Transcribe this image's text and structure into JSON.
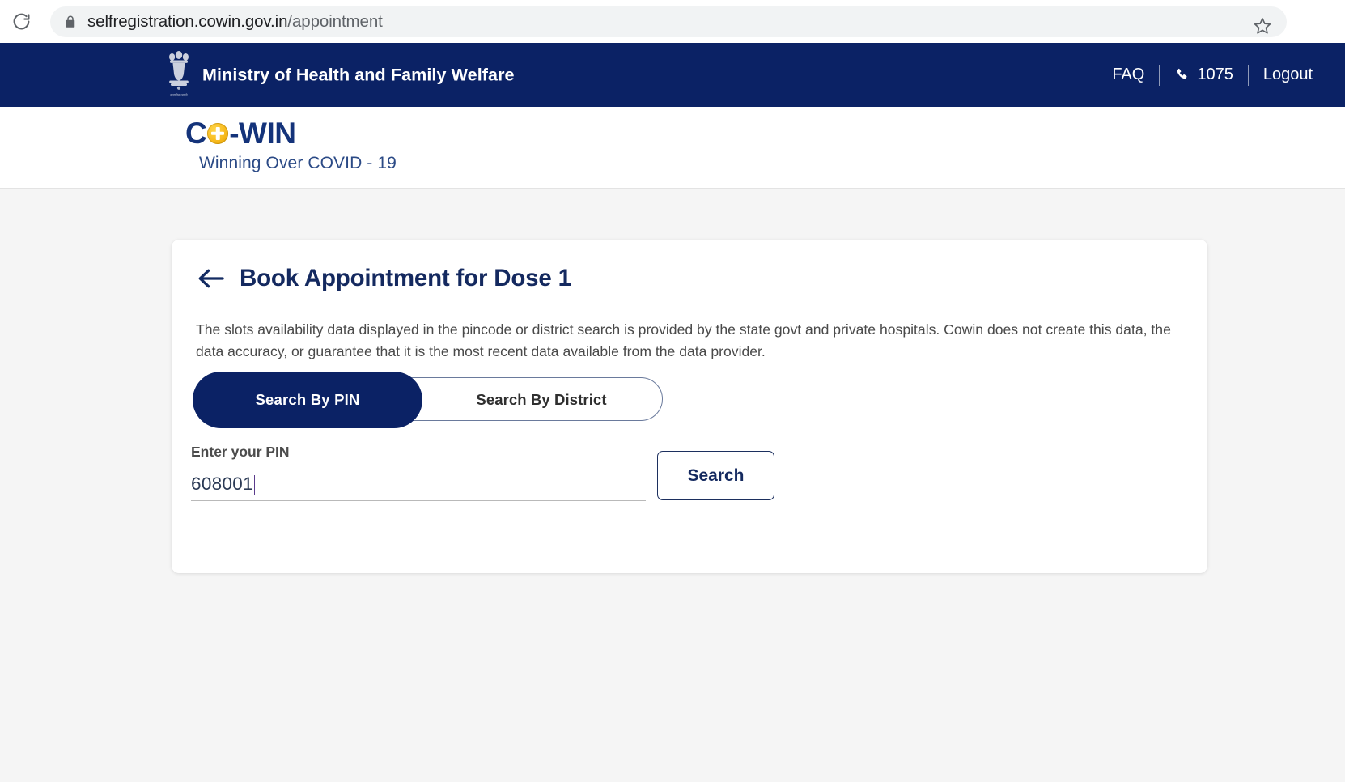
{
  "browser": {
    "reload_icon": "reload-icon",
    "lock_icon": "lock-icon",
    "star_icon": "bookmark-star-icon",
    "url_host": "selfregistration.cowin.gov.in",
    "url_path": "/appointment"
  },
  "gov_header": {
    "emblem_icon": "india-state-emblem-icon",
    "ministry": "Ministry of Health and Family Welfare",
    "faq_label": "FAQ",
    "phone_icon": "phone-icon",
    "helpline": "1075",
    "logout_label": "Logout"
  },
  "brand": {
    "logo_c": "C",
    "logo_plus_icon": "plus-circle-icon",
    "logo_win": "-WIN",
    "tagline": "Winning Over COVID - 19",
    "navy": "#0b2265",
    "yellow": "#f6b719"
  },
  "card": {
    "back_icon": "back-arrow-icon",
    "title": "Book Appointment for Dose 1",
    "disclaimer": "The slots availability data displayed in the pincode or district search is provided by the state govt and private hospitals. Cowin does not create this data, the data accuracy, or guarantee that it is the most recent data available from the data provider.",
    "tabs": [
      {
        "label": "Search By PIN",
        "active": true
      },
      {
        "label": "Search By District",
        "active": false
      }
    ],
    "pin_field": {
      "label": "Enter your PIN",
      "value": "608001",
      "placeholder": "Enter your PIN",
      "focused": true
    },
    "search_button": "Search"
  }
}
